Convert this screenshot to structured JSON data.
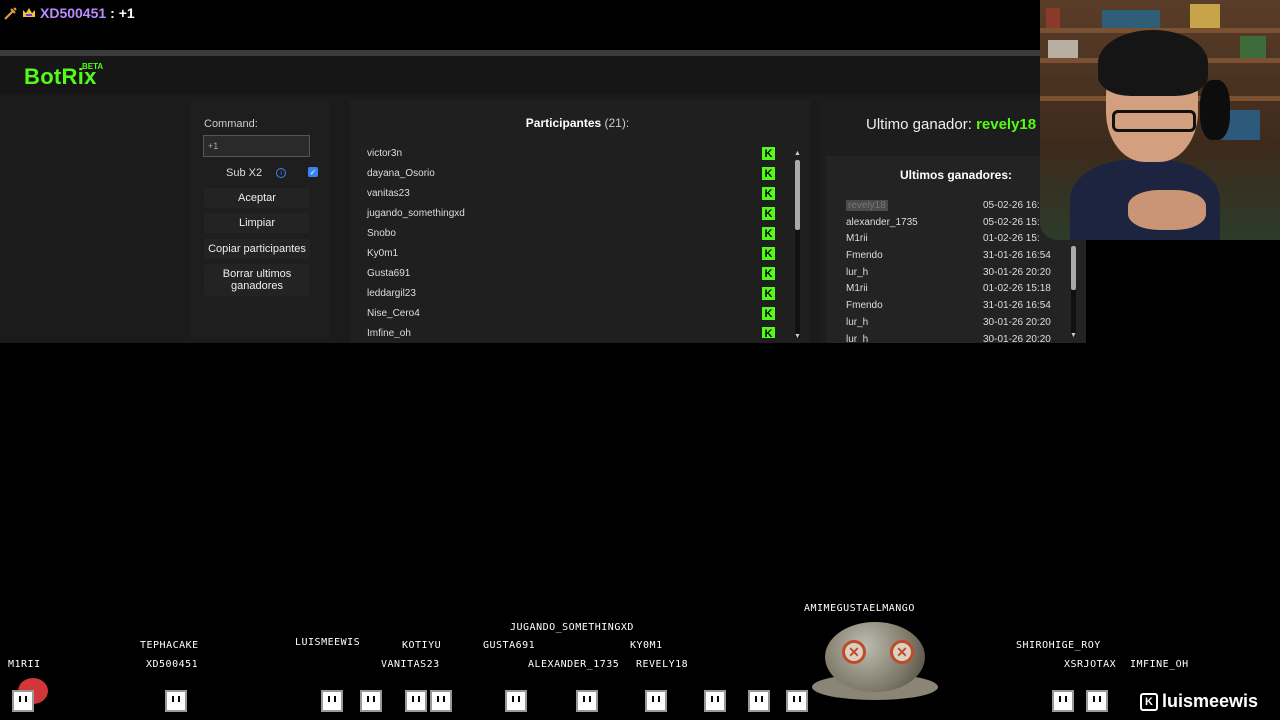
{
  "chat": {
    "user": "XD500451",
    "message": ": +1",
    "colors": {
      "user": "#b98cff"
    }
  },
  "app": {
    "logo": "BotRix",
    "logo_badge": "BETA",
    "command": {
      "label": "Command:",
      "value": "+1"
    },
    "sub_x2": {
      "label": "Sub X2",
      "checked": true
    },
    "buttons": {
      "accept": "Aceptar",
      "clear": "Limpiar",
      "copy": "Copiar participantes",
      "delete_winners": "Borrar ultimos ganadores"
    },
    "participants": {
      "title": "Participantes",
      "count": "(21):",
      "items": [
        "victor3n",
        "dayana_Osorio",
        "vanitas23",
        "jugando_somethingxd",
        "Snobo",
        "Ky0m1",
        "Gusta691",
        "leddargil23",
        "Nise_Cero4",
        "Imfine_oh"
      ]
    },
    "winner": {
      "label": "Ultimo ganador:",
      "name": "revely18"
    },
    "last_winners": {
      "title": "Ultimos ganadores:",
      "rows": [
        {
          "name": "revely18",
          "date": "05-02-26 16:",
          "highlight": true
        },
        {
          "name": "alexander_1735",
          "date": "05-02-26 15:"
        },
        {
          "name": "M1rii",
          "date": "01-02-26 15:"
        },
        {
          "name": "Fmendo",
          "date": "31-01-26 16:54"
        },
        {
          "name": "lur_h",
          "date": "30-01-26 20:20"
        },
        {
          "name": "M1rii",
          "date": "01-02-26 15:18"
        },
        {
          "name": "Fmendo",
          "date": "31-01-26 16:54"
        },
        {
          "name": "lur_h",
          "date": "30-01-26 20:20"
        },
        {
          "name": "lur_h",
          "date": "30-01-26 20:20"
        }
      ]
    },
    "accent": "#53fc18"
  },
  "game": {
    "tags": {
      "m1rii": "M1RII",
      "tephacake": "TEPHACAKE",
      "xd500451": "XD500451",
      "luismeewis": "LUISMEEWIS",
      "kotiyu": "KOTIYU",
      "vanitas23": "VANITAS23",
      "gusta691": "GUSTA691",
      "jugando": "JUGANDO_SOMETHINGXD",
      "ky0m1": "KY0M1",
      "alexander": "ALEXANDER_1735",
      "revely18": "REVELY18",
      "amimegusta": "AMIMEGUSTAELMANGO",
      "shirohige": "SHIROHIGE_ROY",
      "xsrjotax": "XSRJOTAX",
      "imfine": "IMFINE_OH"
    },
    "streamer": "luismeewis"
  }
}
